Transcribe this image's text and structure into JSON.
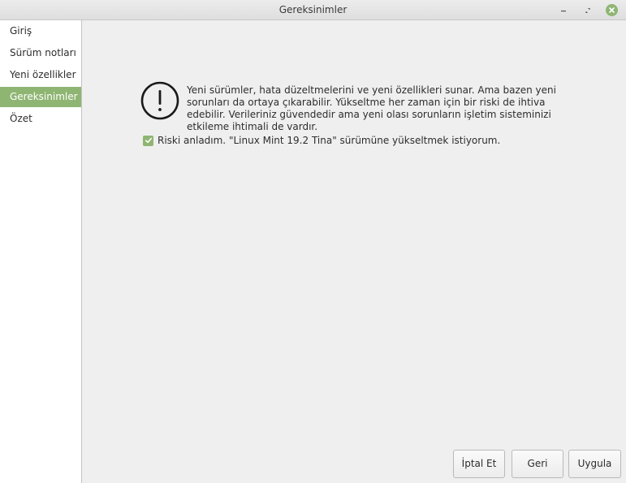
{
  "window": {
    "title": "Gereksinimler"
  },
  "sidebar": {
    "items": [
      {
        "label": "Giriş"
      },
      {
        "label": "Sürüm notları"
      },
      {
        "label": "Yeni özellikler"
      },
      {
        "label": "Gereksinimler",
        "active": true
      },
      {
        "label": "Özet"
      }
    ]
  },
  "main": {
    "warning_icon": "exclamation-circle-icon",
    "message": "Yeni sürümler, hata düzeltmelerini ve yeni özellikleri sunar. Ama bazen yeni sorunları da ortaya çıkarabilir. Yükseltme her zaman için bir riski de ihtiva edebilir. Verileriniz güvendedir ama yeni olası sorunların işletim sisteminizi etkileme ihtimali de vardır.",
    "checkbox": {
      "checked": true,
      "label": "Riski anladım. \"Linux Mint 19.2 Tina\" sürümüne yükseltmek istiyorum."
    }
  },
  "buttons": {
    "cancel": "İptal Et",
    "back": "Geri",
    "apply": "Uygula"
  },
  "colors": {
    "accent": "#8fb573",
    "content_bg": "#efefef",
    "sidebar_bg": "#ffffff"
  }
}
